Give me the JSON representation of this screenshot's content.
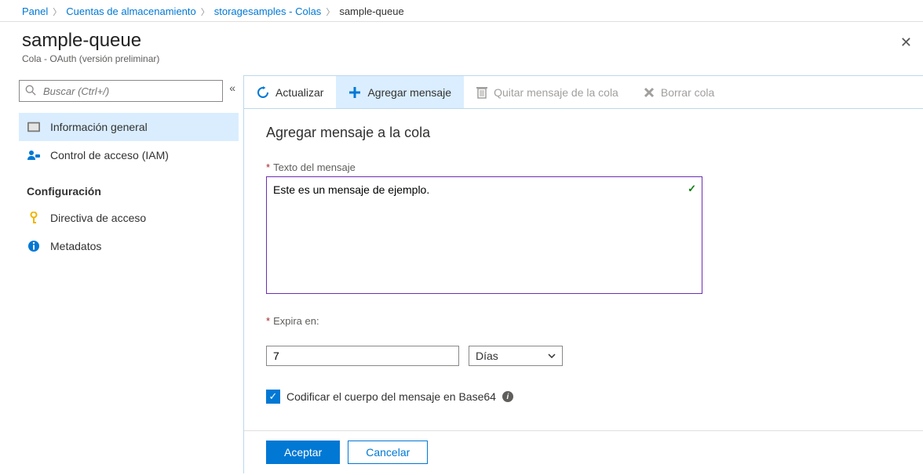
{
  "breadcrumb": {
    "items": [
      {
        "label": "Panel",
        "link": true
      },
      {
        "label": "Cuentas de almacenamiento",
        "link": true
      },
      {
        "label": "storagesamples - Colas",
        "link": true
      },
      {
        "label": "sample-queue",
        "link": false
      }
    ]
  },
  "header": {
    "title": "sample-queue",
    "subtitle": "Cola - OAuth (versión preliminar)"
  },
  "sidebar": {
    "search_placeholder": "Buscar (Ctrl+/)",
    "items": [
      {
        "label": "Información general",
        "selected": true
      },
      {
        "label": "Control de acceso (IAM)",
        "selected": false
      }
    ],
    "settings_section": {
      "title": "Configuración",
      "items": [
        {
          "label": "Directiva de acceso"
        },
        {
          "label": "Metadatos"
        }
      ]
    }
  },
  "toolbar": {
    "refresh": "Actualizar",
    "add_message": "Agregar mensaje",
    "dequeue": "Quitar mensaje de la cola",
    "clear": "Borrar cola"
  },
  "form": {
    "title": "Agregar mensaje a la cola",
    "message_label": "Texto del mensaje",
    "message_value": "Este es un mensaje de ejemplo.",
    "expires_label": "Expira en:",
    "expires_value": "7",
    "expires_unit": "Días",
    "encode_label": "Codificar el cuerpo del mensaje en Base64",
    "encode_checked": true
  },
  "footer": {
    "ok": "Aceptar",
    "cancel": "Cancelar"
  }
}
